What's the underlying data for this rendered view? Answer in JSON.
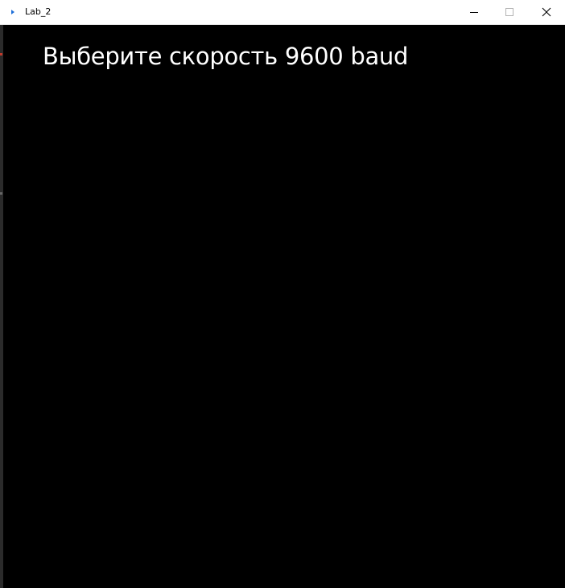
{
  "window": {
    "title": "Lab_2",
    "controls": {
      "minimize": "minimize-icon",
      "maximize": "maximize-icon",
      "close": "close-icon"
    }
  },
  "content": {
    "heading": "Выберите скорость 9600 baud"
  },
  "colors": {
    "canvas_background": "#000000",
    "heading_text": "#ffffff",
    "titlebar_background": "#ffffff",
    "app_icon": "#1e6fd9"
  }
}
